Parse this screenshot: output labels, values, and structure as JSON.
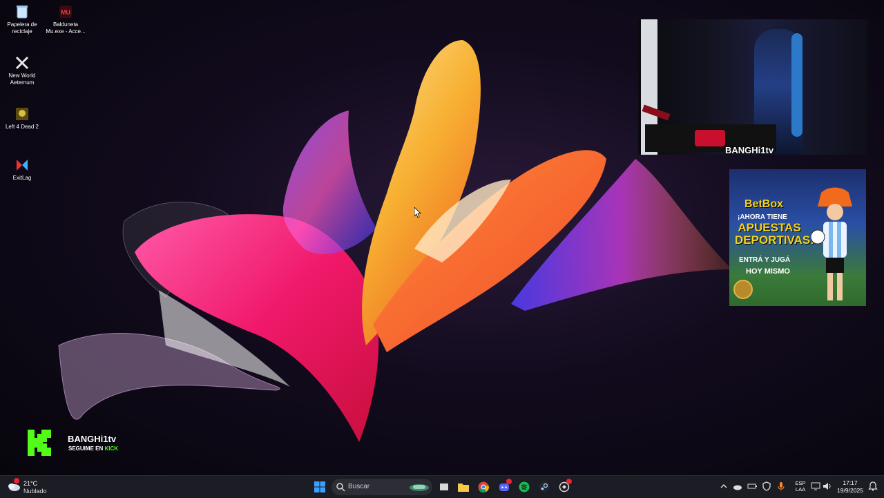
{
  "desktop_icons": [
    {
      "label": "Papelera de reciclaje",
      "icon": "recycle-bin-icon"
    },
    {
      "label": "Balduneta Mu.exe - Acce...",
      "icon": "mu-online-icon"
    },
    {
      "label": "New World Aeternum",
      "icon": "new-world-icon"
    },
    {
      "label": "Left 4 Dead 2",
      "icon": "left4dead2-icon"
    },
    {
      "label": "ExitLag",
      "icon": "exitlag-icon"
    }
  ],
  "webcam": {
    "tag": "BANGHi1tv"
  },
  "ad": {
    "brand": "BetBox",
    "line1": "¡AHORA TIENE",
    "line2": "APUESTAS DEPORTIVAS!",
    "line3": "ENTRÁ Y JUGÁ",
    "line4": "HOY MISMO"
  },
  "kick": {
    "name": "BANGHi1tv",
    "cta_prefix": "SEGUIME EN ",
    "cta_accent": "KICK",
    "accent_color": "#53fc18"
  },
  "taskbar": {
    "weather": {
      "temp": "21°C",
      "condition": "Nublado"
    },
    "search": {
      "placeholder": "Buscar"
    },
    "language": {
      "line1": "ESP",
      "line2": "LAA"
    },
    "clock": {
      "time": "17:17",
      "date": "19/9/2025"
    }
  }
}
